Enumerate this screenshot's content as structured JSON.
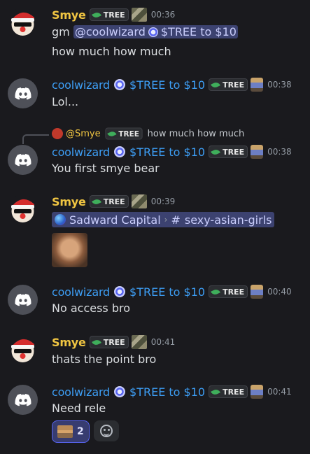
{
  "users": {
    "smye": {
      "name": "Smye",
      "tag": "TREE"
    },
    "coolwizard": {
      "name": "coolwizard",
      "suffix": "$TREE to $10",
      "tag": "TREE"
    }
  },
  "messages": [
    {
      "time": "00:36",
      "lines": [
        "gm",
        "how much how much"
      ],
      "mention": "@coolwizard",
      "mention_suffix": "$TREE to $10"
    },
    {
      "time": "00:38",
      "text": "Lol..."
    },
    {
      "time": "00:38",
      "text": "You first smye bear",
      "reply": {
        "name": "@Smye",
        "tag": "TREE",
        "text": "how much how much"
      }
    },
    {
      "time": "00:39",
      "channel": {
        "server": "Sadward Capital",
        "sep": "›",
        "hash": "#",
        "name": "sexy-asian-girls"
      }
    },
    {
      "time": "00:40",
      "text": "No access bro"
    },
    {
      "time": "00:41",
      "text": "thats the point bro"
    },
    {
      "time": "00:41",
      "text": "Need rele",
      "reactions": [
        {
          "count": "2"
        }
      ]
    }
  ],
  "colors": {
    "background": "#1a1a1e",
    "smye": "#f0c542",
    "coolwizard": "#3d9ef5",
    "mention_bg": "#3c4270"
  }
}
